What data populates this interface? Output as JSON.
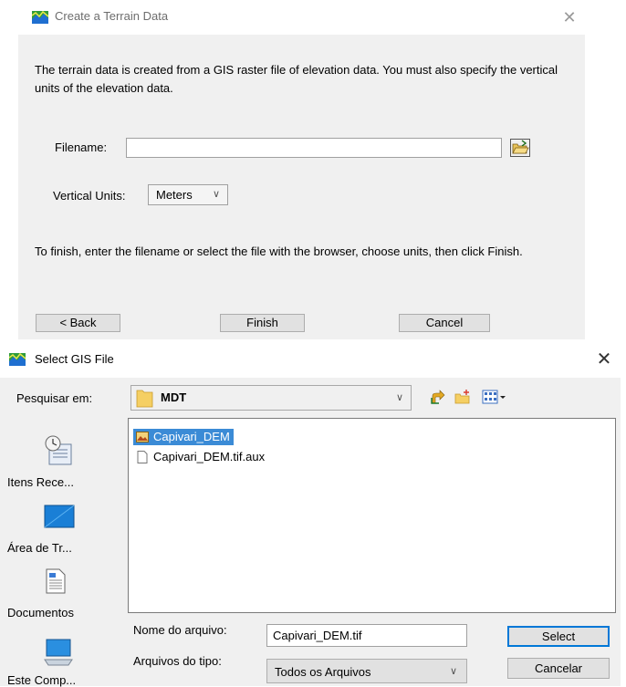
{
  "create_dialog": {
    "title": "Create a Terrain Data",
    "close_glyph": "✕",
    "intro_text": "The terrain data is created from a GIS raster file of elevation data. You must also specify the vertical units of the elevation data.",
    "filename_label": "Filename:",
    "filename_value": "",
    "vertical_units_label": "Vertical Units:",
    "vertical_units_value": "Meters",
    "finish_hint": "To finish, enter the filename or select the file with the browser, choose units, then click Finish.",
    "buttons": {
      "back": "< Back",
      "finish": "Finish",
      "cancel": "Cancel"
    }
  },
  "select_dialog": {
    "title": "Select GIS File",
    "close_glyph": "✕",
    "look_in_label": "Pesquisar em:",
    "look_in_value": "MDT",
    "places": [
      {
        "label": "Itens Rece...",
        "icon": "recent-items-icon"
      },
      {
        "label": "Área de Tr...",
        "icon": "desktop-icon"
      },
      {
        "label": "Documentos",
        "icon": "documents-icon"
      },
      {
        "label": "Este Comp...",
        "icon": "computer-icon"
      }
    ],
    "files": [
      {
        "name": "Capivari_DEM",
        "icon": "raster-file-icon",
        "selected": true
      },
      {
        "name": "Capivari_DEM.tif.aux",
        "icon": "file-icon",
        "selected": false
      }
    ],
    "file_name_label": "Nome do arquivo:",
    "file_name_value": "Capivari_DEM.tif",
    "file_type_label": "Arquivos do tipo:",
    "file_type_value": "Todos os Arquivos",
    "buttons": {
      "select": "Select",
      "cancel": "Cancelar"
    }
  },
  "colors": {
    "selection": "#3b8bd6",
    "dialog_bg": "#f0f0f0",
    "default_button_border": "#0078d7"
  }
}
